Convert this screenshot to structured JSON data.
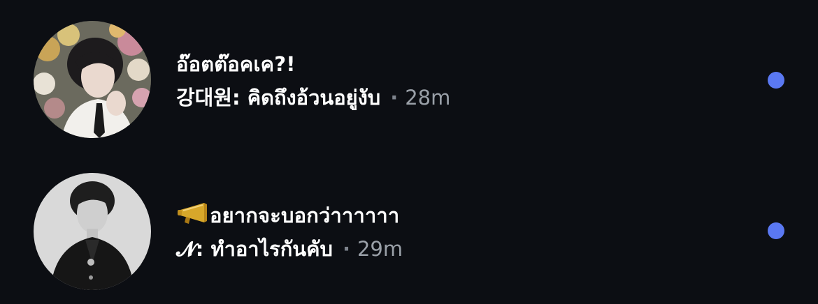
{
  "conversations": [
    {
      "title": "อ๊อตต๊อคเค?!",
      "message": "강대원: คิดถึงอ้วนอยู่งับ",
      "separator": "·",
      "time": "28m",
      "unread": true,
      "avatar_icon": "avatar-photo-person-flowers"
    },
    {
      "title_icon": "megaphone-icon",
      "title": "อยากจะบอกว่าาาาาา",
      "message": "𝓝: ทำอาไรกันคับ",
      "separator": "·",
      "time": "29m",
      "unread": true,
      "avatar_icon": "avatar-photo-person-monochrome"
    }
  ],
  "colors": {
    "background": "#0c0e13",
    "unread_dot": "#5a78f2",
    "secondary_text": "#9aa0a8"
  }
}
